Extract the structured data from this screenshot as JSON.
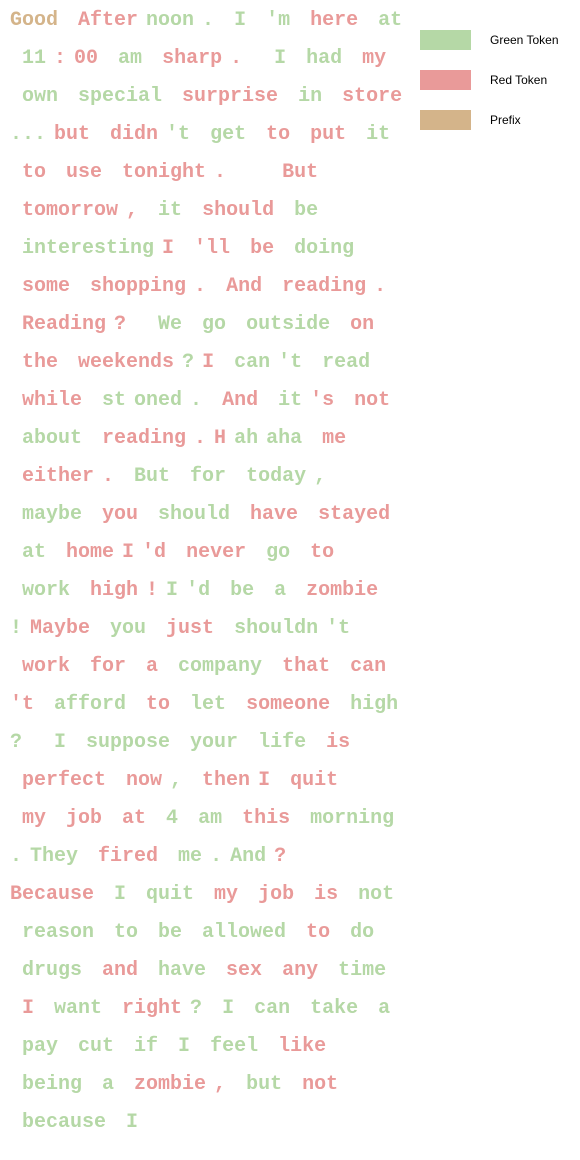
{
  "colors": {
    "g": "#b5d8a6",
    "r": "#e99a99",
    "p": "#d4b48a"
  },
  "legend": [
    {
      "label": "Green Token",
      "type": "g"
    },
    {
      "label": "Red Token",
      "type": "r"
    },
    {
      "label": "Prefix",
      "type": "p"
    }
  ],
  "lines": [
    [
      [
        "Good",
        "p"
      ],
      [
        " After",
        "r"
      ],
      [
        "noon",
        "g"
      ],
      [
        ".",
        "g"
      ],
      [
        " I",
        "g"
      ],
      [
        " 'm",
        "g"
      ],
      [
        " here",
        "r"
      ],
      [
        " at",
        "g"
      ]
    ],
    [
      [
        " 11",
        "g"
      ],
      [
        ":",
        "r"
      ],
      [
        "00",
        "r"
      ],
      [
        " am",
        "g"
      ],
      [
        " sharp",
        "r"
      ],
      [
        ".",
        "r"
      ],
      [
        "  I",
        "g"
      ],
      [
        " had",
        "g"
      ],
      [
        " my",
        "r"
      ]
    ],
    [
      [
        " own",
        "g"
      ],
      [
        " special",
        "g"
      ],
      [
        " surprise",
        "r"
      ],
      [
        " in",
        "g"
      ],
      [
        " store",
        "r"
      ]
    ],
    [
      [
        "...",
        "g"
      ],
      [
        "but",
        "r"
      ],
      [
        " didn",
        "r"
      ],
      [
        "'t",
        "g"
      ],
      [
        " get",
        "g"
      ],
      [
        " to",
        "r"
      ],
      [
        " put",
        "r"
      ],
      [
        " it",
        "g"
      ]
    ],
    [
      [
        " to",
        "r"
      ],
      [
        " use",
        "r"
      ],
      [
        " tonight",
        "r"
      ],
      [
        ".",
        "r"
      ],
      [
        "    But",
        "r"
      ]
    ],
    [
      [
        " tomorrow",
        "r"
      ],
      [
        ",",
        "r"
      ],
      [
        " it",
        "g"
      ],
      [
        " should",
        "r"
      ],
      [
        " be",
        "g"
      ]
    ],
    [
      [
        " interesting",
        "g"
      ],
      [
        "I",
        "r"
      ],
      [
        " 'll",
        "r"
      ],
      [
        " be",
        "r"
      ],
      [
        " doing",
        "g"
      ]
    ],
    [
      [
        " some",
        "r"
      ],
      [
        " shopping",
        "r"
      ],
      [
        ".",
        "r"
      ],
      [
        " And",
        "r"
      ],
      [
        " reading",
        "r"
      ],
      [
        ".",
        "r"
      ]
    ],
    [
      [
        " Reading",
        "r"
      ],
      [
        "?",
        "r"
      ],
      [
        "  We",
        "g"
      ],
      [
        " go",
        "g"
      ],
      [
        " outside",
        "g"
      ],
      [
        " on",
        "r"
      ]
    ],
    [
      [
        " the",
        "r"
      ],
      [
        " weekends",
        "r"
      ],
      [
        "?",
        "g"
      ],
      [
        "I",
        "r"
      ],
      [
        " can",
        "g"
      ],
      [
        "'t",
        "g"
      ],
      [
        " read",
        "g"
      ]
    ],
    [
      [
        " while",
        "r"
      ],
      [
        " st",
        "g"
      ],
      [
        "oned",
        "g"
      ],
      [
        ".",
        "g"
      ],
      [
        " And",
        "r"
      ],
      [
        " it",
        "g"
      ],
      [
        "'s",
        "r"
      ],
      [
        " not",
        "r"
      ]
    ],
    [
      [
        " about",
        "g"
      ],
      [
        " reading",
        "r"
      ],
      [
        ".",
        "r"
      ],
      [
        "H",
        "r"
      ],
      [
        "ah",
        "g"
      ],
      [
        "aha",
        "g"
      ],
      [
        " me",
        "r"
      ]
    ],
    [
      [
        " either",
        "r"
      ],
      [
        ".",
        "r"
      ],
      [
        " But",
        "g"
      ],
      [
        " for",
        "g"
      ],
      [
        " today",
        "g"
      ],
      [
        ",",
        "g"
      ]
    ],
    [
      [
        " maybe",
        "g"
      ],
      [
        " you",
        "r"
      ],
      [
        " should",
        "g"
      ],
      [
        " have",
        "r"
      ],
      [
        " stayed",
        "r"
      ]
    ],
    [
      [
        " at",
        "g"
      ],
      [
        " home",
        "r"
      ],
      [
        "I",
        "r"
      ],
      [
        "'d",
        "r"
      ],
      [
        " never",
        "r"
      ],
      [
        " go",
        "g"
      ],
      [
        " to",
        "r"
      ]
    ],
    [
      [
        " work",
        "g"
      ],
      [
        " high",
        "r"
      ],
      [
        "!",
        "r"
      ],
      [
        "I",
        "g"
      ],
      [
        "'d",
        "g"
      ],
      [
        " be",
        "g"
      ],
      [
        " a",
        "g"
      ],
      [
        " zombie",
        "r"
      ]
    ],
    [
      [
        "!",
        "g"
      ],
      [
        "Maybe",
        "r"
      ],
      [
        " you",
        "g"
      ],
      [
        " just",
        "r"
      ],
      [
        " shouldn",
        "g"
      ],
      [
        "'t",
        "g"
      ]
    ],
    [
      [
        " work",
        "r"
      ],
      [
        " for",
        "r"
      ],
      [
        " a",
        "r"
      ],
      [
        " company",
        "g"
      ],
      [
        " that",
        "r"
      ],
      [
        " can",
        "r"
      ]
    ],
    [
      [
        "'t",
        "r"
      ],
      [
        " afford",
        "g"
      ],
      [
        " to",
        "r"
      ],
      [
        " let",
        "g"
      ],
      [
        " someone",
        "r"
      ],
      [
        " high",
        "g"
      ]
    ],
    [
      [
        "?",
        "g"
      ],
      [
        "  I",
        "g"
      ],
      [
        " suppose",
        "g"
      ],
      [
        " your",
        "g"
      ],
      [
        " life",
        "g"
      ],
      [
        " is",
        "r"
      ]
    ],
    [
      [
        " perfect",
        "r"
      ],
      [
        " now",
        "r"
      ],
      [
        ",",
        "g"
      ],
      [
        " then",
        "r"
      ],
      [
        "I",
        "r"
      ],
      [
        " quit",
        "r"
      ]
    ],
    [
      [
        " my",
        "r"
      ],
      [
        " job",
        "r"
      ],
      [
        " at",
        "r"
      ],
      [
        " 4",
        "g"
      ],
      [
        " am",
        "g"
      ],
      [
        " this",
        "r"
      ],
      [
        " morning",
        "g"
      ]
    ],
    [
      [
        ".",
        "g"
      ],
      [
        "They",
        "g"
      ],
      [
        " fired",
        "r"
      ],
      [
        " me",
        "g"
      ],
      [
        ".",
        "g"
      ],
      [
        "And",
        "g"
      ],
      [
        "?",
        "r"
      ]
    ],
    [
      [
        "Because",
        "r"
      ],
      [
        " I",
        "g"
      ],
      [
        " quit",
        "g"
      ],
      [
        " my",
        "r"
      ],
      [
        " job",
        "r"
      ],
      [
        " is",
        "r"
      ],
      [
        " not",
        "g"
      ]
    ],
    [
      [
        " reason",
        "g"
      ],
      [
        " to",
        "g"
      ],
      [
        " be",
        "g"
      ],
      [
        " allowed",
        "g"
      ],
      [
        " to",
        "r"
      ],
      [
        " do",
        "g"
      ]
    ],
    [
      [
        " drugs",
        "g"
      ],
      [
        " and",
        "r"
      ],
      [
        " have",
        "g"
      ],
      [
        " sex",
        "r"
      ],
      [
        " any",
        "r"
      ],
      [
        " time",
        "g"
      ]
    ],
    [
      [
        " I",
        "r"
      ],
      [
        " want",
        "g"
      ],
      [
        " right",
        "r"
      ],
      [
        "?",
        "g"
      ],
      [
        " I",
        "g"
      ],
      [
        " can",
        "g"
      ],
      [
        " take",
        "g"
      ],
      [
        " a",
        "g"
      ]
    ],
    [
      [
        " pay",
        "g"
      ],
      [
        " cut",
        "g"
      ],
      [
        " if",
        "g"
      ],
      [
        " I",
        "g"
      ],
      [
        " feel",
        "g"
      ],
      [
        " like",
        "r"
      ]
    ],
    [
      [
        " being",
        "g"
      ],
      [
        " a",
        "g"
      ],
      [
        " zombie",
        "r"
      ],
      [
        ",",
        "r"
      ],
      [
        " but",
        "g"
      ],
      [
        " not",
        "r"
      ]
    ],
    [
      [
        " because",
        "g"
      ],
      [
        " I",
        "g"
      ]
    ]
  ]
}
